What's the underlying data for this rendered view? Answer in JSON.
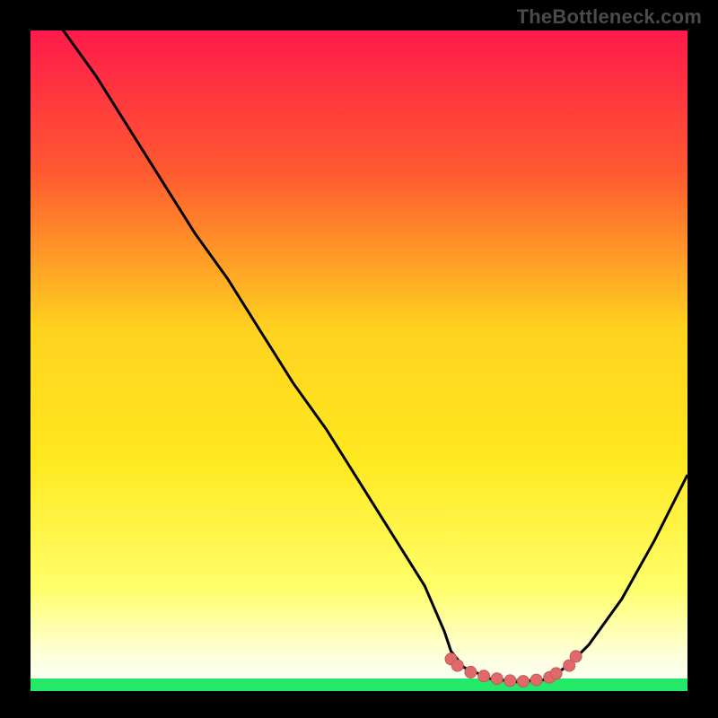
{
  "watermark": "TheBottleneck.com",
  "colors": {
    "background": "#000000",
    "gradient_top": "#ff1a4b",
    "gradient_mid_upper": "#ff6a2a",
    "gradient_mid": "#ffd21f",
    "gradient_lower": "#ffff6a",
    "gradient_bottom": "#fffff0",
    "green_band": "#23e868",
    "curve_stroke": "#000000",
    "marker_fill": "#e06a6a",
    "marker_stroke": "#c55858",
    "watermark": "#4a4a4a"
  },
  "chart_data": {
    "type": "line",
    "title": "",
    "xlabel": "",
    "ylabel": "",
    "xlim": [
      0,
      100
    ],
    "ylim": [
      0,
      100
    ],
    "note": "Axes are normalized 0–100 across the visible plot area. y=0 sits on the green band at the bottom; y=100 at the top edge.",
    "series": [
      {
        "name": "bottleneck-curve",
        "x": [
          0,
          5,
          10,
          15,
          20,
          25,
          30,
          35,
          40,
          45,
          50,
          55,
          60,
          63,
          64,
          66,
          70,
          74,
          78,
          80,
          82,
          85,
          90,
          95,
          100
        ],
        "y": [
          106,
          100,
          93,
          85,
          77,
          69,
          62,
          54,
          46,
          39,
          31,
          23,
          15,
          8,
          5,
          2.5,
          0.8,
          0.3,
          0.6,
          1.5,
          3,
          6,
          13,
          22,
          32
        ]
      }
    ],
    "markers": {
      "name": "highlighted-points",
      "x": [
        64,
        65,
        67,
        69,
        71,
        73,
        75,
        77,
        79,
        80,
        82,
        83
      ],
      "y": [
        3.8,
        2.8,
        1.8,
        1.2,
        0.8,
        0.5,
        0.4,
        0.6,
        1.0,
        1.6,
        2.8,
        4.2
      ]
    }
  }
}
